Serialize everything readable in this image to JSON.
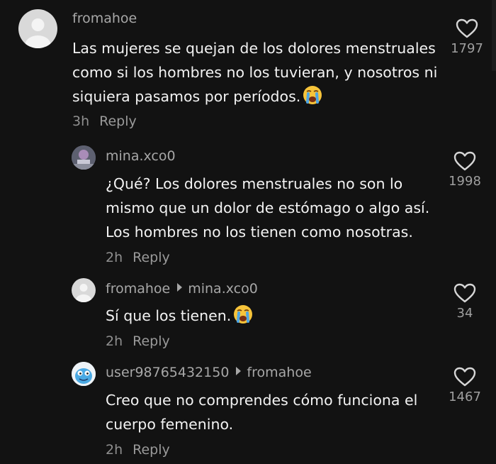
{
  "comments": [
    {
      "username": "fromahoe",
      "reply_to": "",
      "text": "Las mujeres se quejan de los dolores menstruales como si los hombres no los tuvieran, y nosotros ni siquiera pasamos por períodos.",
      "has_emoji": true,
      "time": "3h",
      "reply_label": "Reply",
      "likes": "1797"
    },
    {
      "username": "mina.xco0",
      "reply_to": "",
      "text": "¿Qué? Los dolores menstruales no son lo mismo que un dolor de estómago o algo así. Los hombres no los tienen como nosotras.",
      "has_emoji": false,
      "time": "2h",
      "reply_label": "Reply",
      "likes": "1998"
    },
    {
      "username": "fromahoe",
      "reply_to": "mina.xco0",
      "text": "Sí que los tienen.",
      "has_emoji": true,
      "time": "2h",
      "reply_label": "Reply",
      "likes": "34"
    },
    {
      "username": "user98765432150",
      "reply_to": "fromahoe",
      "text": "Creo que no comprendes cómo funciona el cuerpo femenino.",
      "has_emoji": false,
      "time": "2h",
      "reply_label": "Reply",
      "likes": "1467"
    }
  ],
  "colors": {
    "background": "#121212",
    "text": "#f3f3f3",
    "muted": "#a7a7a7"
  },
  "icons": {
    "like": "heart-outline-icon",
    "emoji": "loudly-crying-face-emoji",
    "reply_arrow": "triangle-right-icon"
  }
}
